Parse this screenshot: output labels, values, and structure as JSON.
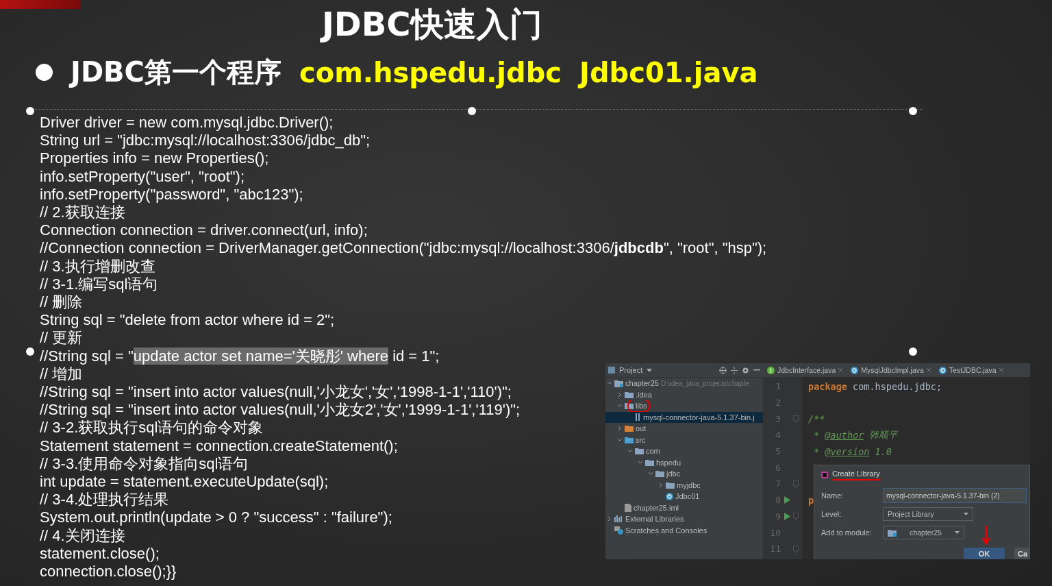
{
  "title": "JDBC快速入门",
  "heading": {
    "label": "JDBC第一个程序",
    "package": "com.hspedu.jdbc",
    "file": "Jdbc01.java"
  },
  "code_lines": [
    {
      "kind": "plain",
      "text": "Driver driver = new com.mysql.jdbc.Driver();"
    },
    {
      "kind": "plain",
      "text": "String url = \"jdbc:mysql://localhost:3306/jdbc_db\";"
    },
    {
      "kind": "plain",
      "text": "Properties info = new Properties();"
    },
    {
      "kind": "plain",
      "text": "info.setProperty(\"user\", \"root\");"
    },
    {
      "kind": "plain",
      "text": "info.setProperty(\"password\", \"abc123\");"
    },
    {
      "kind": "plain",
      "text": "// 2.获取连接"
    },
    {
      "kind": "plain",
      "text": "Connection connection = driver.connect(url, info);"
    },
    {
      "kind": "plain",
      "text": "//Connection connection = DriverManager.getConnection(\"jdbc:mysql://localhost:3306/**jdbcdb**\", \"root\", \"hsp\");"
    },
    {
      "kind": "plain",
      "text": "// 3.执行增删改查"
    },
    {
      "kind": "plain",
      "text": "// 3-1.编写sql语句"
    },
    {
      "kind": "plain",
      "text": "// 删除"
    },
    {
      "kind": "plain",
      "text": "String sql = \"delete from actor where id = 2\";"
    },
    {
      "kind": "plain",
      "text": "// 更新"
    },
    {
      "kind": "parts",
      "parts": [
        {
          "text": "//String sql = \"",
          "selected": false
        },
        {
          "text": "update actor set name='关晓彤' where",
          "selected": true
        },
        {
          "text": " id = 1\";",
          "selected": false
        }
      ]
    },
    {
      "kind": "plain",
      "text": "// 增加"
    },
    {
      "kind": "plain",
      "text": "//String sql = \"insert into actor values(null,'小龙女','女','1998-1-1','110')\";"
    },
    {
      "kind": "plain",
      "text": "//String sql = \"insert into actor values(null,'小龙女2','女','1999-1-1','119')\";"
    },
    {
      "kind": "plain",
      "text": "// 3-2.获取执行sql语句的命令对象"
    },
    {
      "kind": "plain",
      "text": "Statement statement = connection.createStatement();"
    },
    {
      "kind": "plain",
      "text": "// 3-3.使用命令对象指向sql语句"
    },
    {
      "kind": "plain",
      "text": "int update = statement.executeUpdate(sql);"
    },
    {
      "kind": "plain",
      "text": "// 3-4.处理执行结果"
    },
    {
      "kind": "plain",
      "text": "System.out.println(update > 0 ? \"success\" : \"failure\");"
    },
    {
      "kind": "plain",
      "text": "// 4.关闭连接"
    },
    {
      "kind": "plain",
      "text": "statement.close();"
    },
    {
      "kind": "plain",
      "text": "connection.close();}}"
    }
  ],
  "ide": {
    "project_panel": {
      "title": "Project",
      "tree": [
        {
          "kind": "module",
          "label": "chapter25",
          "path": "D:\\idea_java_projects\\chapte",
          "expanded": true,
          "selected": false,
          "children": [
            {
              "kind": "folder",
              "label": ".idea",
              "expanded": false,
              "selected": false
            },
            {
              "kind": "folder",
              "label": "libs",
              "expanded": true,
              "selected": false,
              "circled": true,
              "children": [
                {
                  "kind": "jar",
                  "label": "mysql-connector-java-5.1.37-bin.j",
                  "selected": true
                }
              ]
            },
            {
              "kind": "excluded",
              "label": "out",
              "expanded": false,
              "selected": false
            },
            {
              "kind": "source",
              "label": "src",
              "expanded": true,
              "selected": false,
              "children": [
                {
                  "kind": "folder",
                  "label": "com",
                  "expanded": true,
                  "selected": false,
                  "children": [
                    {
                      "kind": "folder",
                      "label": "hspedu",
                      "expanded": true,
                      "selected": false,
                      "children": [
                        {
                          "kind": "folder",
                          "label": "jdbc",
                          "expanded": true,
                          "selected": false,
                          "children": [
                            {
                              "kind": "folder",
                              "label": "myjdbc",
                              "expanded": false,
                              "selected": false
                            },
                            {
                              "kind": "class",
                              "label": "Jdbc01",
                              "selected": false
                            }
                          ]
                        }
                      ]
                    }
                  ]
                }
              ]
            },
            {
              "kind": "file",
              "label": "chapter25.iml",
              "selected": false
            }
          ]
        },
        {
          "kind": "libraries",
          "label": "External Libraries",
          "expanded": false,
          "selected": false
        },
        {
          "kind": "scratches",
          "label": "Scratches and Consoles",
          "selected": false
        }
      ]
    },
    "tabs": [
      {
        "kind": "interface",
        "label": "JdbcInterface.java",
        "selected": false
      },
      {
        "kind": "class",
        "label": "MysqlJdbcImpl.java",
        "selected": false
      },
      {
        "kind": "class",
        "label": "TestJDBC.java",
        "selected": false
      }
    ],
    "editor_lines": [
      {
        "number": "1",
        "tokens": [
          {
            "kind": "keyword",
            "text": "package"
          },
          {
            "kind": "plain",
            "text": " com.hspedu.jdbc;"
          }
        ]
      },
      {
        "number": "2"
      },
      {
        "number": "3",
        "fold": true,
        "tokens": [
          {
            "kind": "comment",
            "text": "/**"
          }
        ]
      },
      {
        "number": "4",
        "tokens": [
          {
            "kind": "comment",
            "text": " * "
          },
          {
            "kind": "tag",
            "text": "@author"
          },
          {
            "kind": "comment",
            "text": " 韩顺平"
          }
        ]
      },
      {
        "number": "5",
        "tokens": [
          {
            "kind": "comment",
            "text": " * "
          },
          {
            "kind": "tag",
            "text": "@version"
          },
          {
            "kind": "comment",
            "text": " 1.0"
          }
        ]
      },
      {
        "number": "6"
      },
      {
        "number": "7",
        "fold": true
      },
      {
        "number": "8",
        "run": true,
        "tokens": [
          {
            "kind": "keyword",
            "text": "p"
          }
        ]
      },
      {
        "number": "9",
        "run": true,
        "fold": true
      },
      {
        "number": "10"
      },
      {
        "number": "11",
        "fold": true
      }
    ],
    "dialog": {
      "title": "Create Library",
      "fields": [
        {
          "kind": "input",
          "label": "Name:",
          "value": "mysql-connector-java-5.1.37-bin (2)"
        },
        {
          "kind": "select",
          "label": "Level:",
          "value": "Project Library"
        },
        {
          "kind": "module",
          "label": "Add to module:",
          "value": "chapter25"
        }
      ],
      "buttons": [
        {
          "label": "OK",
          "primary": true
        },
        {
          "label": "Ca",
          "primary": false
        }
      ]
    }
  }
}
